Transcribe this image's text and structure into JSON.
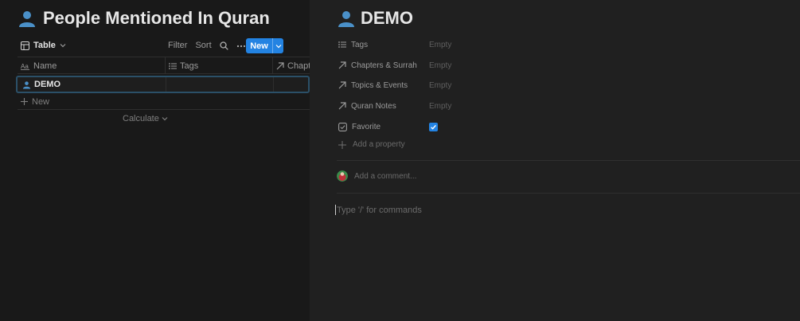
{
  "left_panel": {
    "title": "People Mentioned In Quran",
    "toolbar": {
      "view_label": "Table",
      "filter_label": "Filter",
      "sort_label": "Sort",
      "new_label": "New"
    },
    "columns": [
      {
        "label": "Name",
        "icon": "text-aa-icon"
      },
      {
        "label": "Tags",
        "icon": "list-icon"
      },
      {
        "label": "Chapte",
        "icon": "relation-arrow-icon"
      }
    ],
    "rows": [
      {
        "name": "DEMO"
      }
    ],
    "new_row_label": "New",
    "calculate_label": "Calculate"
  },
  "peek": {
    "title": "DEMO",
    "properties": [
      {
        "name": "Tags",
        "icon": "list-icon",
        "value": "Empty"
      },
      {
        "name": "Chapters & Surrah",
        "icon": "relation-arrow-icon",
        "value": "Empty"
      },
      {
        "name": "Topics & Events",
        "icon": "relation-arrow-icon",
        "value": "Empty"
      },
      {
        "name": "Quran Notes",
        "icon": "relation-arrow-icon",
        "value": "Empty"
      },
      {
        "name": "Favorite",
        "icon": "checkbox-icon",
        "value": "",
        "checked": true
      }
    ],
    "add_property_label": "Add a property",
    "comment_placeholder": "Add a comment...",
    "editor_placeholder": "Type '/' for commands"
  },
  "colors": {
    "accent": "#2383e2",
    "page_icon": "#4a90c8"
  }
}
